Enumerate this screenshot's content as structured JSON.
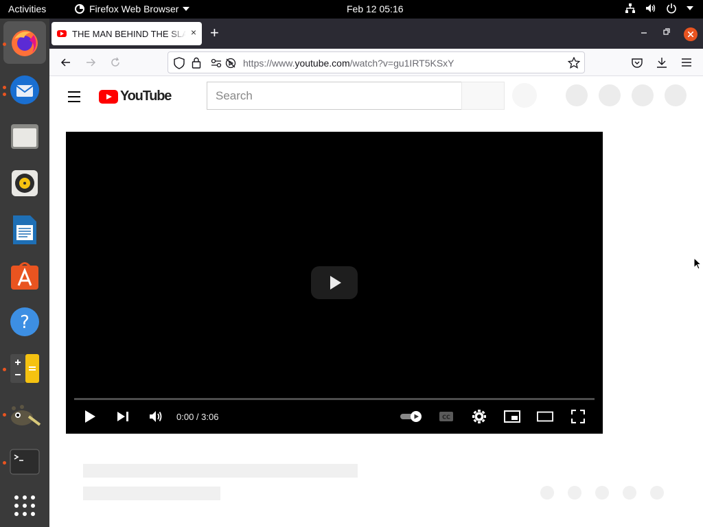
{
  "topbar": {
    "activities": "Activities",
    "app_name": "Firefox Web Browser",
    "clock": "Feb 12  05:16",
    "icons": [
      "network-icon",
      "volume-icon",
      "power-icon",
      "chevron-down-icon"
    ]
  },
  "dock": {
    "items": [
      "firefox",
      "thunderbird",
      "files",
      "rhythmbox",
      "libreoffice-writer",
      "ubuntu-software",
      "help",
      "calculator",
      "gimp",
      "terminal",
      "show-applications"
    ]
  },
  "browser": {
    "tab_title": "THE MAN BEHIND THE SLAUGHTER",
    "tab_close": "×",
    "new_tab": "+",
    "url_prefix": "https://www.",
    "url_domain": "youtube.com",
    "url_path": "/watch?v=gu1IRT5KSxY"
  },
  "youtube": {
    "logo_text": "YouTube",
    "search_placeholder": "Search",
    "player": {
      "time": "0:00 / 3:06",
      "progress": 0
    }
  },
  "colors": {
    "accent": "#e95420",
    "youtube_red": "#ff0000",
    "tabbar": "#2b2a33"
  }
}
